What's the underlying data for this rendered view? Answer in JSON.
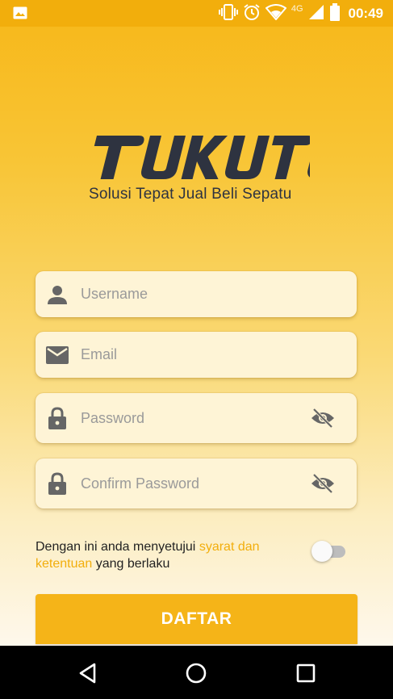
{
  "status_bar": {
    "time": "00:49",
    "network": "4G",
    "icons": [
      "image-icon",
      "vibrate-icon",
      "alarm-icon",
      "wifi-icon",
      "signal-icon",
      "battery-icon"
    ]
  },
  "brand": {
    "logo_text": "TUKUTU",
    "tagline": "Solusi Tepat Jual Beli Sepatu",
    "logo_color": "#2E3340"
  },
  "form": {
    "username": {
      "placeholder": "Username",
      "value": "",
      "icon": "person-icon"
    },
    "email": {
      "placeholder": "Email",
      "value": "",
      "icon": "mail-icon"
    },
    "password": {
      "placeholder": "Password",
      "value": "",
      "icon": "lock-icon",
      "toggle_icon": "eye-off-icon"
    },
    "confirm_password": {
      "placeholder": "Confirm Password",
      "value": "",
      "icon": "lock-icon",
      "toggle_icon": "eye-off-icon"
    }
  },
  "terms": {
    "prefix": "Dengan ini anda menyetujui ",
    "link": "syarat dan ketentuan",
    "suffix": " yang berlaku",
    "accepted": false
  },
  "submit_label": "DAFTAR",
  "colors": {
    "accent": "#F5B418",
    "link": "#F2AE0C"
  },
  "nav": [
    "back-icon",
    "home-icon",
    "recents-icon"
  ]
}
